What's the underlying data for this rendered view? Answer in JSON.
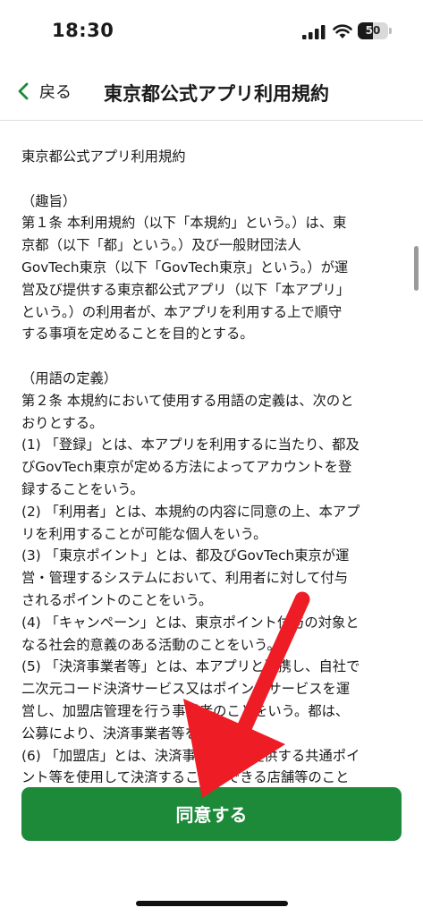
{
  "status_bar": {
    "time": "18:30",
    "battery_percent": "50",
    "battery_level": 0.5
  },
  "nav": {
    "back_label": "戻る",
    "title": "東京都公式アプリ利用規約"
  },
  "terms": {
    "heading": "東京都公式アプリ利用規約",
    "sections": [
      {
        "caption": "（趣旨）",
        "lines": [
          "第１条 本利用規約（以下「本規約」という。）は、東",
          "京都（以下「都」という。）及び一般財団法人",
          "GovTech東京（以下「GovTech東京」という。）が運",
          "営及び提供する東京都公式アプリ（以下「本アプリ」",
          "という。）の利用者が、本アプリを利用する上で順守",
          "する事項を定めることを目的とする。"
        ]
      },
      {
        "caption": "（用語の定義）",
        "lines": [
          "第２条 本規約において使用する用語の定義は、次のと",
          "おりとする。",
          "(1) 「登録」とは、本アプリを利用するに当たり、都及",
          "びGovTech東京が定める方法によってアカウントを登",
          "録することをいう。",
          "(2) 「利用者」とは、本規約の内容に同意の上、本アプ",
          "リを利用することが可能な個人をいう。",
          "(3) 「東京ポイント」とは、都及びGovTech東京が運",
          "営・管理するシステムにおいて、利用者に対して付与",
          "されるポイントのことをいう。",
          "(4) 「キャンペーン」とは、東京ポイント付与の対象と",
          "なる社会的意義のある活動のことをいう。",
          "(5) 「決済事業者等」とは、本アプリと連携し、自社で",
          "二次元コード決済サービス又はポイントサービスを運",
          "営し、加盟店管理を行う事業者のことをいう。都は、",
          "公募により、決済事業者等を決定する。",
          "(6) 「加盟店」とは、決済事業者等が提供する共通ポイ",
          "ント等を使用して決済することができる店舗等のこと"
        ]
      }
    ]
  },
  "agree_button": {
    "label": "同意する"
  },
  "colors": {
    "accent_green": "#1d8a3a",
    "annotation_red": "#ee1c25"
  },
  "icons": {
    "back": "chevron-left-icon",
    "signal": "cellular-signal-icon",
    "wifi": "wifi-icon",
    "battery": "battery-icon"
  }
}
